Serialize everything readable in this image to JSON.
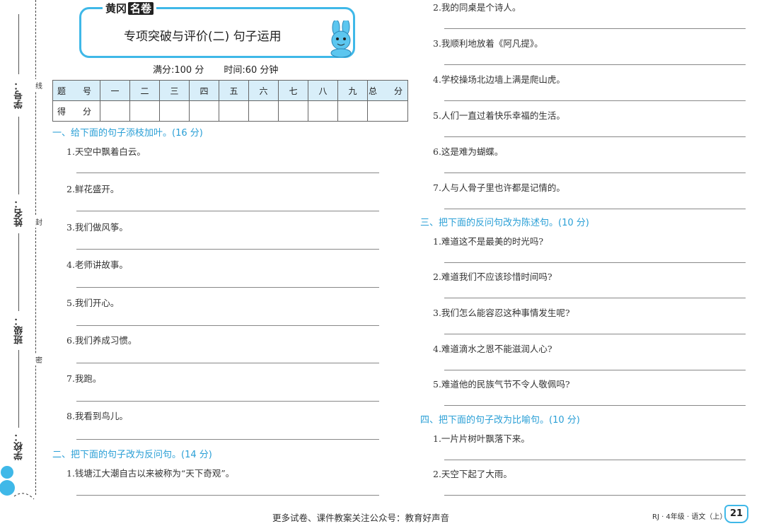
{
  "binding": {
    "labels": [
      "学号：",
      "姓名：",
      "班级：",
      "学校："
    ],
    "seals": [
      "线",
      "封",
      "密"
    ]
  },
  "header": {
    "brand": "黄冈",
    "brand_tag": "名卷",
    "title": "专项突破与评价(二)  句子运用"
  },
  "meta": {
    "full_score": "满分:100 分",
    "time": "时间:60 分钟"
  },
  "score_table": {
    "head": [
      "题　号",
      "一",
      "二",
      "三",
      "四",
      "五",
      "六",
      "七",
      "八",
      "九",
      "总　分"
    ],
    "row_label": "得　分"
  },
  "sections": {
    "s1": {
      "title": "一、给下面的句子添枝加叶。(16 分)",
      "items": [
        "1.天空中飘着白云。",
        "2.鲜花盛开。",
        "3.我们做风筝。",
        "4.老师讲故事。",
        "5.我们开心。",
        "6.我们养成习惯。",
        "7.我跑。",
        "8.我看到鸟儿。"
      ]
    },
    "s2": {
      "title": "二、把下面的句子改为反问句。(14 分)",
      "items": [
        "1.钱塘江大潮自古以来被称为“天下奇观”。",
        "2.我的同桌是个诗人。",
        "3.我顺利地放着《阿凡提》。",
        "4.学校操场北边墙上满是爬山虎。",
        "5.人们一直过着快乐幸福的生活。",
        "6.这是难为蝴蝶。",
        "7.人与人骨子里也许都是记情的。"
      ]
    },
    "s3": {
      "title": "三、把下面的反问句改为陈述句。(10 分)",
      "items": [
        "1.难道这不是最美的时光吗?",
        "2.难道我们不应该珍惜时间吗?",
        "3.我们怎么能容忍这种事情发生呢?",
        "4.难道滴水之恩不能滋润人心?",
        "5.难道他的民族气节不令人敬佩吗?"
      ]
    },
    "s4": {
      "title": "四、把下面的句子改为比喻句。(10 分)",
      "items": [
        "1.一片片树叶飘落下来。",
        "2.天空下起了大雨。"
      ]
    }
  },
  "footer": {
    "notice": "更多试卷、课件教案关注公众号：教育好声音",
    "grade": "RJ · 4年级 · 语文（上）",
    "page": "21"
  }
}
